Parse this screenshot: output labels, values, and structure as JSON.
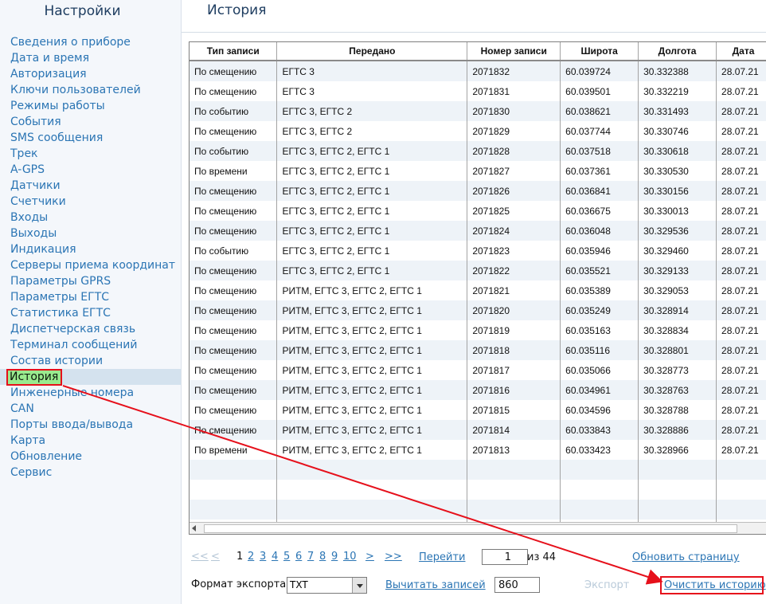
{
  "sidebar": {
    "title": "Настройки",
    "items": [
      {
        "label": "Сведения о приборе"
      },
      {
        "label": "Дата и время"
      },
      {
        "label": "Авторизация"
      },
      {
        "label": "Ключи пользователей"
      },
      {
        "label": "Режимы работы"
      },
      {
        "label": "События"
      },
      {
        "label": "SMS сообщения"
      },
      {
        "label": "Трек"
      },
      {
        "label": "A-GPS"
      },
      {
        "label": "Датчики"
      },
      {
        "label": "Счетчики"
      },
      {
        "label": "Входы"
      },
      {
        "label": "Выходы"
      },
      {
        "label": "Индикация"
      },
      {
        "label": "Серверы приема координат"
      },
      {
        "label": "Параметры GPRS"
      },
      {
        "label": "Параметры ЕГТС"
      },
      {
        "label": "Статистика ЕГТС"
      },
      {
        "label": "Диспетчерская связь"
      },
      {
        "label": "Терминал сообщений"
      },
      {
        "label": "Состав истории"
      },
      {
        "label": "История",
        "active": true
      },
      {
        "label": "Инженерные номера"
      },
      {
        "label": "CAN"
      },
      {
        "label": "Порты ввода/вывода"
      },
      {
        "label": "Карта"
      },
      {
        "label": "Обновление"
      },
      {
        "label": "Сервис"
      }
    ]
  },
  "main": {
    "title": "История",
    "table": {
      "columns": [
        "Тип записи",
        "Передано",
        "Номер записи",
        "Широта",
        "Долгота",
        "Дата"
      ],
      "rows": [
        [
          "По смещению",
          "ЕГТС 3",
          "2071832",
          "60.039724",
          "30.332388",
          "28.07.21"
        ],
        [
          "По смещению",
          "ЕГТС 3",
          "2071831",
          "60.039501",
          "30.332219",
          "28.07.21"
        ],
        [
          "По событию",
          "ЕГТС 3, ЕГТС 2",
          "2071830",
          "60.038621",
          "30.331493",
          "28.07.21"
        ],
        [
          "По смещению",
          "ЕГТС 3, ЕГТС 2",
          "2071829",
          "60.037744",
          "30.330746",
          "28.07.21"
        ],
        [
          "По событию",
          "ЕГТС 3, ЕГТС 2, ЕГТС 1",
          "2071828",
          "60.037518",
          "30.330618",
          "28.07.21"
        ],
        [
          "По времени",
          "ЕГТС 3, ЕГТС 2, ЕГТС 1",
          "2071827",
          "60.037361",
          "30.330530",
          "28.07.21"
        ],
        [
          "По смещению",
          "ЕГТС 3, ЕГТС 2, ЕГТС 1",
          "2071826",
          "60.036841",
          "30.330156",
          "28.07.21"
        ],
        [
          "По смещению",
          "ЕГТС 3, ЕГТС 2, ЕГТС 1",
          "2071825",
          "60.036675",
          "30.330013",
          "28.07.21"
        ],
        [
          "По смещению",
          "ЕГТС 3, ЕГТС 2, ЕГТС 1",
          "2071824",
          "60.036048",
          "30.329536",
          "28.07.21"
        ],
        [
          "По событию",
          "ЕГТС 3, ЕГТС 2, ЕГТС 1",
          "2071823",
          "60.035946",
          "30.329460",
          "28.07.21"
        ],
        [
          "По смещению",
          "ЕГТС 3, ЕГТС 2, ЕГТС 1",
          "2071822",
          "60.035521",
          "30.329133",
          "28.07.21"
        ],
        [
          "По смещению",
          "РИТМ, ЕГТС 3, ЕГТС 2, ЕГТС 1",
          "2071821",
          "60.035389",
          "30.329053",
          "28.07.21"
        ],
        [
          "По смещению",
          "РИТМ, ЕГТС 3, ЕГТС 2, ЕГТС 1",
          "2071820",
          "60.035249",
          "30.328914",
          "28.07.21"
        ],
        [
          "По смещению",
          "РИТМ, ЕГТС 3, ЕГТС 2, ЕГТС 1",
          "2071819",
          "60.035163",
          "30.328834",
          "28.07.21"
        ],
        [
          "По смещению",
          "РИТМ, ЕГТС 3, ЕГТС 2, ЕГТС 1",
          "2071818",
          "60.035116",
          "30.328801",
          "28.07.21"
        ],
        [
          "По смещению",
          "РИТМ, ЕГТС 3, ЕГТС 2, ЕГТС 1",
          "2071817",
          "60.035066",
          "30.328773",
          "28.07.21"
        ],
        [
          "По смещению",
          "РИТМ, ЕГТС 3, ЕГТС 2, ЕГТС 1",
          "2071816",
          "60.034961",
          "30.328763",
          "28.07.21"
        ],
        [
          "По смещению",
          "РИТМ, ЕГТС 3, ЕГТС 2, ЕГТС 1",
          "2071815",
          "60.034596",
          "30.328788",
          "28.07.21"
        ],
        [
          "По смещению",
          "РИТМ, ЕГТС 3, ЕГТС 2, ЕГТС 1",
          "2071814",
          "60.033843",
          "30.328886",
          "28.07.21"
        ],
        [
          "По времени",
          "РИТМ, ЕГТС 3, ЕГТС 2, ЕГТС 1",
          "2071813",
          "60.033423",
          "30.328966",
          "28.07.21"
        ]
      ],
      "empty_rows": 3
    },
    "pager": {
      "first": "<<",
      "prev": "<",
      "pages": [
        "1",
        "2",
        "3",
        "4",
        "5",
        "6",
        "7",
        "8",
        "9",
        "10"
      ],
      "current": "1",
      "next": ">",
      "last": ">>",
      "goto_label": "Перейти",
      "page_input": "1",
      "of_label": "из 44",
      "refresh_label": "Обновить страницу"
    },
    "export": {
      "format_label": "Формат экспорта",
      "format_value": "TXT",
      "read_label": "Вычитать записей",
      "read_count": "860",
      "export_label": "Экспорт",
      "clear_label": "Очистить историю"
    }
  },
  "annotation": {
    "color": "#e6101b"
  }
}
